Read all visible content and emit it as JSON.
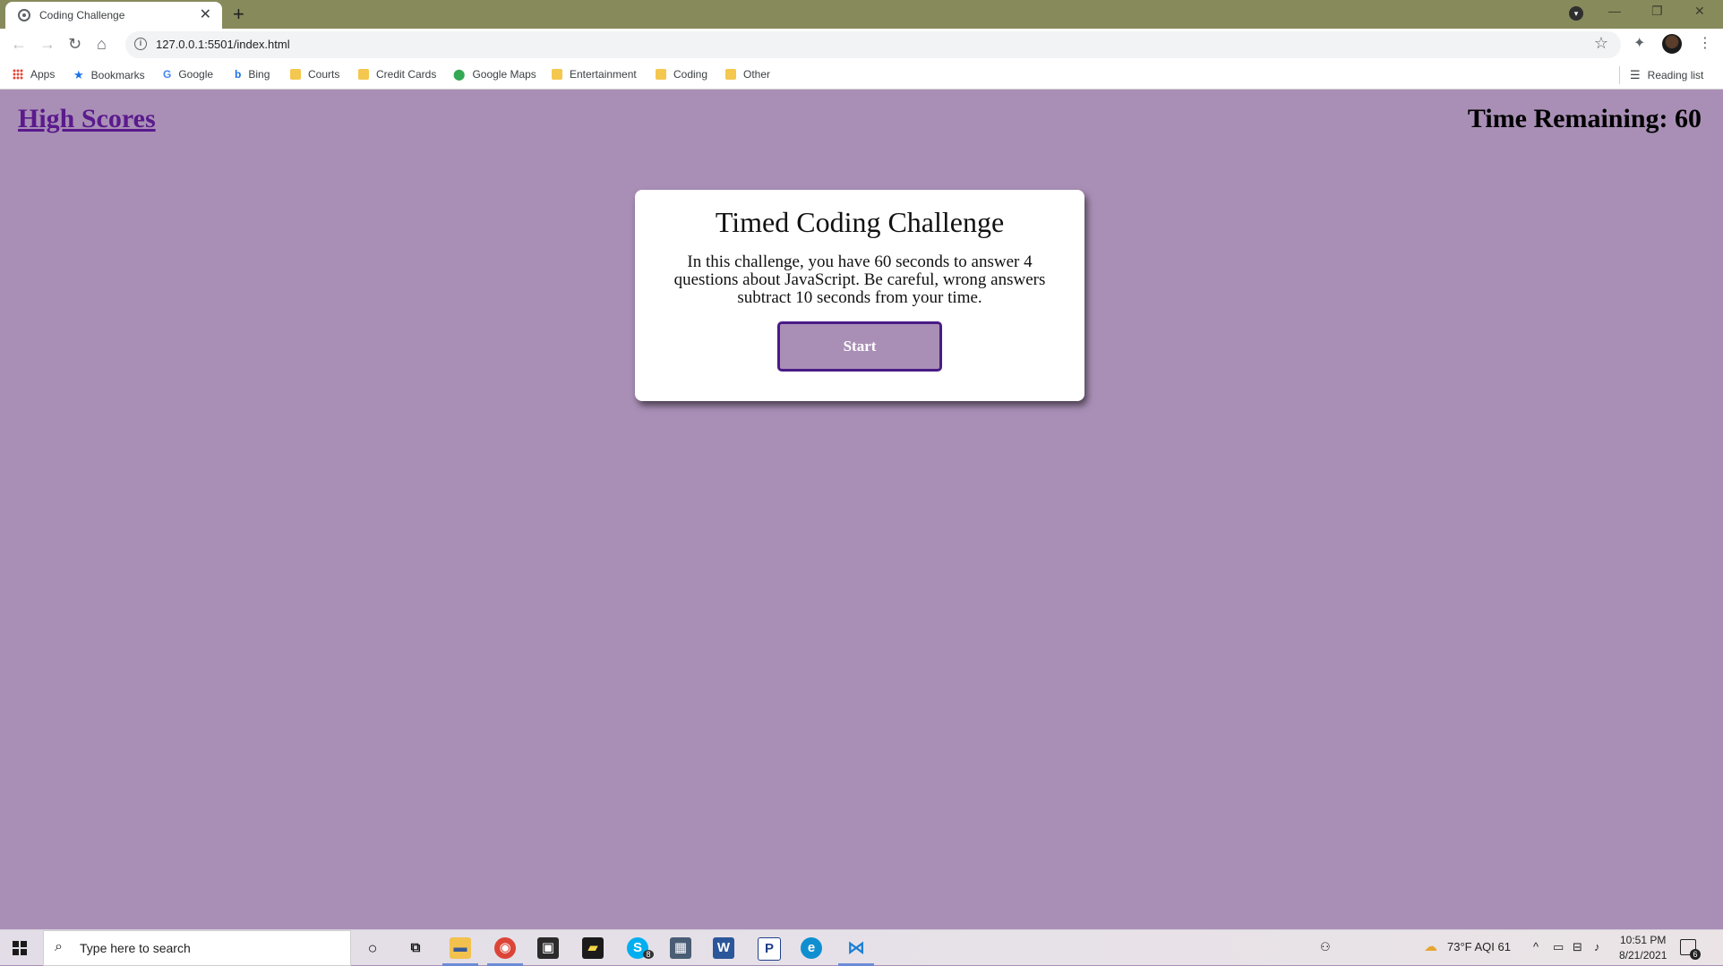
{
  "browser": {
    "tab_title": "Coding Challenge",
    "tab_close": "✕",
    "new_tab": "+",
    "url": "127.0.0.1:5501/index.html",
    "window_controls": {
      "minimize": "—",
      "restore": "❐",
      "close": "✕"
    }
  },
  "bookmarks": [
    {
      "label": "Apps",
      "icon": "apps-grid-icon"
    },
    {
      "label": "Bookmarks",
      "icon": "star-icon"
    },
    {
      "label": "Google",
      "icon": "google-icon"
    },
    {
      "label": "Bing",
      "icon": "bing-icon"
    },
    {
      "label": "Courts",
      "icon": "folder-icon"
    },
    {
      "label": "Credit Cards",
      "icon": "folder-icon"
    },
    {
      "label": "Google Maps",
      "icon": "map-pin-icon"
    },
    {
      "label": "Entertainment",
      "icon": "folder-icon"
    },
    {
      "label": "Coding",
      "icon": "folder-icon"
    },
    {
      "label": "Other",
      "icon": "folder-icon"
    }
  ],
  "reading_list": "Reading list",
  "page": {
    "high_scores": "High Scores",
    "timer": "Time Remaining: 60",
    "card": {
      "title": "Timed Coding Challenge",
      "description": "In this challenge, you have 60 seconds to answer 4 questions about JavaScript. Be careful, wrong answers subtract 10 seconds from your time.",
      "start_button": "Start"
    },
    "colors": {
      "background": "#a98fb6",
      "link": "#5a1a8c",
      "button_border": "#4a1b86"
    }
  },
  "taskbar": {
    "search_placeholder": "Type here to search",
    "weather": "73°F  AQI 61",
    "time": "10:51 PM",
    "date": "8/21/2021",
    "skype_badge": "8",
    "notifications_count": "6"
  }
}
